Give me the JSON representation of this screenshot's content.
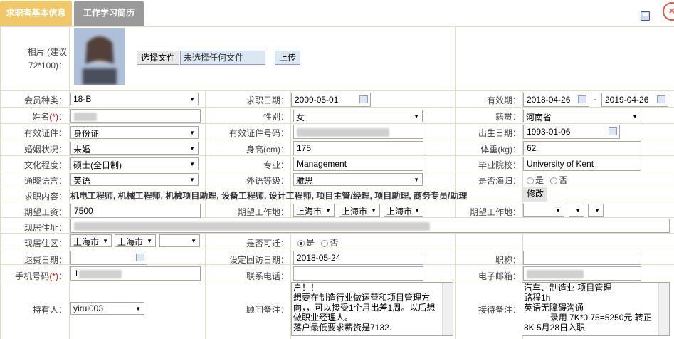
{
  "tabs": [
    {
      "label": "求职者基本信息",
      "active": true
    },
    {
      "label": "工作学习简历",
      "active": false
    }
  ],
  "photo": {
    "label_line1": "相片 (建议",
    "label_line2": "72*100)：",
    "choose_button": "选择文件",
    "file_status": "未选择任何文件",
    "upload_button": "上传"
  },
  "row_member": {
    "label": "会员种类：",
    "value": "18-B"
  },
  "row_jobdate": {
    "label": "求职日期：",
    "value": "2009-05-01"
  },
  "row_validity": {
    "label": "有效期：",
    "from": "2018-04-26",
    "sep": "-",
    "to": "2019-04-26"
  },
  "row_name": {
    "label": "姓名",
    "req": "(*)",
    "colon": "："
  },
  "row_gender": {
    "label": "性别：",
    "value": "女"
  },
  "row_native": {
    "label": "籍贯：",
    "value": "河南省"
  },
  "row_idtype": {
    "label": "有效证件：",
    "value": "身份证"
  },
  "row_idno": {
    "label": "有效证件号码："
  },
  "row_birth": {
    "label": "出生日期：",
    "value": "1993-01-06"
  },
  "row_marital": {
    "label": "婚姻状况：",
    "value": "未婚"
  },
  "row_height": {
    "label": "身高(cm)：",
    "value": "175"
  },
  "row_weight": {
    "label": "体重(kg)：",
    "value": "62"
  },
  "row_edu": {
    "label": "文化程度：",
    "value": "硕士(全日制)"
  },
  "row_major": {
    "label": "专业：",
    "value": "Management"
  },
  "row_school": {
    "label": "毕业院校：",
    "value": "University of Kent"
  },
  "row_lang": {
    "label": "通晓语言：",
    "value": "英语"
  },
  "row_forlevel": {
    "label": "外语等级：",
    "value": "雅思"
  },
  "row_overseas": {
    "label": "是否海归：",
    "yes": "是",
    "no": "否"
  },
  "row_jobcontent": {
    "label": "求职内容：",
    "value": "机电工程师, 机械工程师, 机械项目助理, 设备工程师, 设计工程师, 项目主管/经理, 项目助理, 商务专员/助理",
    "edit": "修改"
  },
  "row_salary": {
    "label": "期望工资：",
    "value": "7500"
  },
  "row_workplace": {
    "label": "期望工作地：",
    "a": "上海市",
    "b": "上海市",
    "c": "上海市"
  },
  "row_workplace2": {
    "label": "期望工作地："
  },
  "row_address": {
    "label": "现居住址："
  },
  "row_district": {
    "label": "现居住区：",
    "a": "上海市",
    "b": "上海市"
  },
  "row_relocate": {
    "label": "是否可迁：",
    "yes": "是",
    "no": "否"
  },
  "row_refund": {
    "label": "退费日期："
  },
  "row_visit": {
    "label": "设定回访日期：",
    "value": "2018-05-24"
  },
  "row_title": {
    "label": "职称："
  },
  "row_mobile": {
    "label": "手机号码",
    "req": "(*)",
    "colon": "：",
    "prefix": "1"
  },
  "row_phone": {
    "label": "联系电话："
  },
  "row_email": {
    "label": "电子邮箱："
  },
  "row_holder": {
    "label": "持有人：",
    "value": "yirui003"
  },
  "row_consultant": {
    "label": "顾问备注：",
    "text": "户！！\n想要在制造行业做运营和项目管理方向，，可以接受1个月出差1周。以后想做职业经理人。\n落户最低要求薪资是7132."
  },
  "row_reception": {
    "label": "接待备注：",
    "text": "汽车、制造业 项目管理\n路程1h\n英语无障碍沟通\n           录用 7K*0.75=5250元 转正8K 5月28日入职"
  }
}
